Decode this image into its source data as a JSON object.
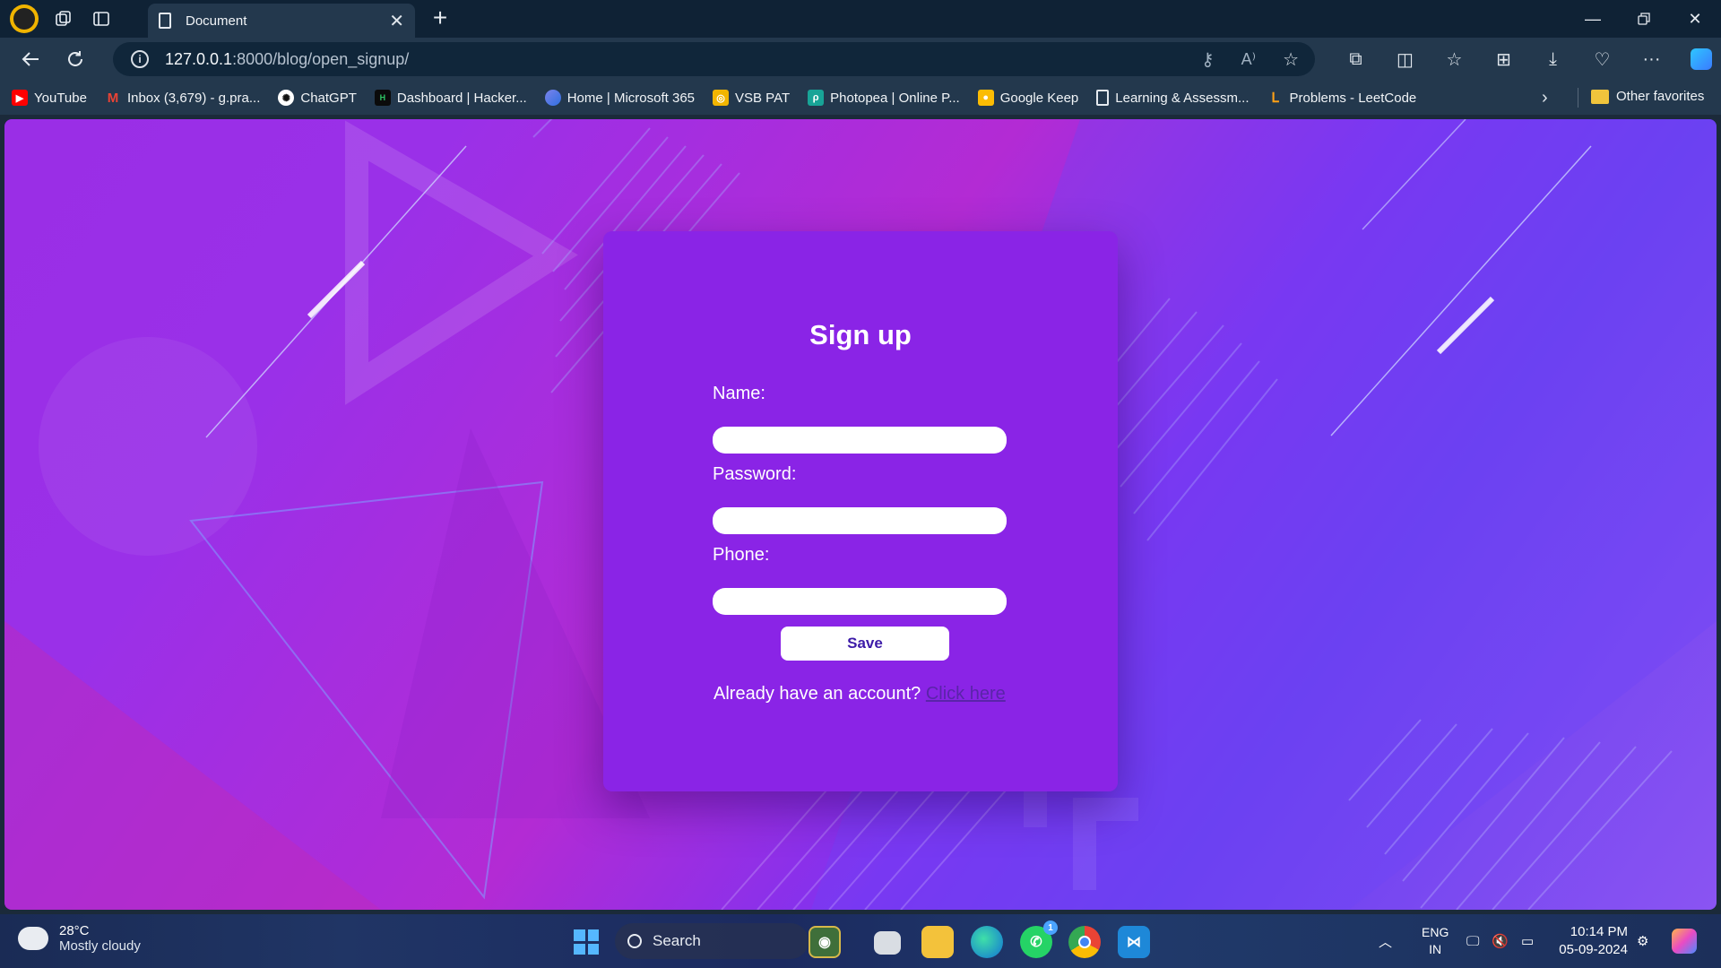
{
  "browser": {
    "tab_title": "Document",
    "url_host": "127.0.0.1",
    "url_path": ":8000/blog/open_signup/"
  },
  "favorites": [
    {
      "label": "YouTube",
      "icon": "youtube-icon",
      "color": "#ff0000"
    },
    {
      "label": "Inbox (3,679) - g.pra...",
      "icon": "gmail-icon",
      "color": "#ea4335"
    },
    {
      "label": "ChatGPT",
      "icon": "chatgpt-icon",
      "color": "#10a37f"
    },
    {
      "label": "Dashboard | Hacker...",
      "icon": "hackerrank-icon",
      "color": "#1b1b1b"
    },
    {
      "label": "Home | Microsoft 365",
      "icon": "microsoft365-icon",
      "color": "#6b7ff5"
    },
    {
      "label": "VSB PAT",
      "icon": "vsb-icon",
      "color": "#f2b500"
    },
    {
      "label": "Photopea | Online P...",
      "icon": "photopea-icon",
      "color": "#18a497"
    },
    {
      "label": "Google Keep",
      "icon": "keep-icon",
      "color": "#fbbc04"
    },
    {
      "label": "Learning & Assessm...",
      "icon": "page-icon",
      "color": "#23384d"
    },
    {
      "label": "Problems - LeetCode",
      "icon": "leetcode-icon",
      "color": "#23384d"
    }
  ],
  "favorites_other": "Other favorites",
  "form": {
    "heading": "Sign up",
    "name_label": "Name:",
    "password_label": "Password:",
    "phone_label": "Phone:",
    "save_label": "Save",
    "already_text": "Already have an account?",
    "login_link": "Click here"
  },
  "taskbar": {
    "temperature": "28°C",
    "weather": "Mostly cloudy",
    "search_label": "Search",
    "lang_1": "ENG",
    "lang_2": "IN",
    "time": "10:14 PM",
    "date": "05-09-2024",
    "whatsapp_badge": "1"
  }
}
